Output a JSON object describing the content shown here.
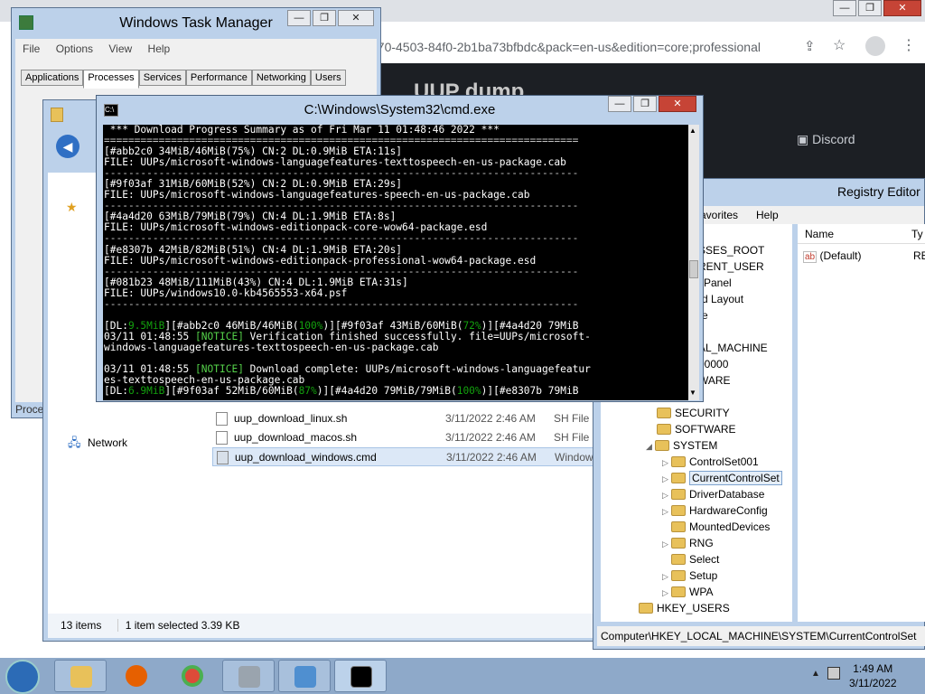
{
  "browser": {
    "address": "b70-4503-84f0-2b1ba73bfbdc&pack=en-us&edition=core;professional",
    "banner_title": "UUP dump",
    "discord_label": "Discord"
  },
  "task_manager": {
    "title": "Windows Task Manager",
    "menu": [
      "File",
      "Options",
      "View",
      "Help"
    ],
    "tabs": [
      "Applications",
      "Processes",
      "Services",
      "Performance",
      "Networking",
      "Users"
    ],
    "active_tab": "Processes",
    "status_text": "Proce"
  },
  "explorer": {
    "nav_network": "Network",
    "files": [
      {
        "name": "uup_download_linux.sh",
        "date": "3/11/2022 2:46 AM",
        "type": "SH File"
      },
      {
        "name": "uup_download_macos.sh",
        "date": "3/11/2022 2:46 AM",
        "type": "SH File"
      },
      {
        "name": "uup_download_windows.cmd",
        "date": "3/11/2022 2:46 AM",
        "type": "Window"
      }
    ],
    "status_items": "13 items",
    "status_selected": "1 item selected  3.39 KB"
  },
  "registry": {
    "title": "Registry Editor",
    "menu_favorites": "avorites",
    "menu_help": "Help",
    "col_name": "Name",
    "col_type": "Ty",
    "value_default": "(Default)",
    "value_type_fragment": "RE",
    "tree_top": [
      "SSES_ROOT",
      "RENT_USER",
      "l Panel",
      "rd Layout",
      "re",
      "",
      "AL_MACHINE",
      "00000",
      "WARE"
    ],
    "tree_items": [
      "SECURITY",
      "SOFTWARE",
      "SYSTEM",
      "ControlSet001",
      "CurrentControlSet",
      "DriverDatabase",
      "HardwareConfig",
      "MountedDevices",
      "RNG",
      "Select",
      "Setup",
      "WPA",
      "HKEY_USERS"
    ],
    "path": "Computer\\HKEY_LOCAL_MACHINE\\SYSTEM\\CurrentControlSet"
  },
  "cmd": {
    "title": "C:\\Windows\\System32\\cmd.exe",
    "header": " *** Download Progress Summary as of Fri Mar 11 01:48:46 2022 ***",
    "rule": "==============================================================================",
    "dash": "------------------------------------------------------------------------------",
    "blocks": [
      {
        "status": "[#abb2c0 34MiB/46MiB(75%) CN:2 DL:0.9MiB ETA:11s]",
        "file": "FILE: UUPs/microsoft-windows-languagefeatures-texttospeech-en-us-package.cab"
      },
      {
        "status": "[#9f03af 31MiB/60MiB(52%) CN:2 DL:0.9MiB ETA:29s]",
        "file": "FILE: UUPs/microsoft-windows-languagefeatures-speech-en-us-package.cab"
      },
      {
        "status": "[#4a4d20 63MiB/79MiB(79%) CN:4 DL:1.9MiB ETA:8s]",
        "file": "FILE: UUPs/microsoft-windows-editionpack-core-wow64-package.esd"
      },
      {
        "status": "[#e8307b 42MiB/82MiB(51%) CN:4 DL:1.9MiB ETA:20s]",
        "file": "FILE: UUPs/microsoft-windows-editionpack-professional-wow64-package.esd"
      },
      {
        "status": "[#081b23 48MiB/111MiB(43%) CN:4 DL:1.9MiB ETA:31s]",
        "file": "FILE: UUPs/windows10.0-kb4565553-x64.psf"
      }
    ],
    "line1_a": "[DL:",
    "line1_b": "9.5MiB",
    "line1_c": "][#abb2c0 46MiB/46MiB(",
    "line1_d": "100%",
    "line1_e": ")][#9f03af 43MiB/60MiB(",
    "line1_f": "72%",
    "line1_g": ")][#4a4d20 79MiB",
    "notice1_time": "03/11 01:48:55 ",
    "notice_tag": "[NOTICE]",
    "notice1_text": " Verification finished successfully. file=UUPs/microsoft-",
    "notice1_cont": "windows-languagefeatures-texttospeech-en-us-package.cab",
    "notice2_time": "03/11 01:48:55 ",
    "notice2_text": " Download complete: UUPs/microsoft-windows-languagefeatur",
    "notice2_cont": "es-texttospeech-en-us-package.cab",
    "line2_a": "[DL:",
    "line2_b": "6.9MiB",
    "line2_c": "][#9f03af 52MiB/60MiB(",
    "line2_d": "87%",
    "line2_e": ")][#4a4d20 79MiB/79MiB(",
    "line2_f": "100%",
    "line2_g": ")][#e8307b 79MiB"
  },
  "clock": {
    "time": "1:49 AM",
    "date": "3/11/2022"
  }
}
